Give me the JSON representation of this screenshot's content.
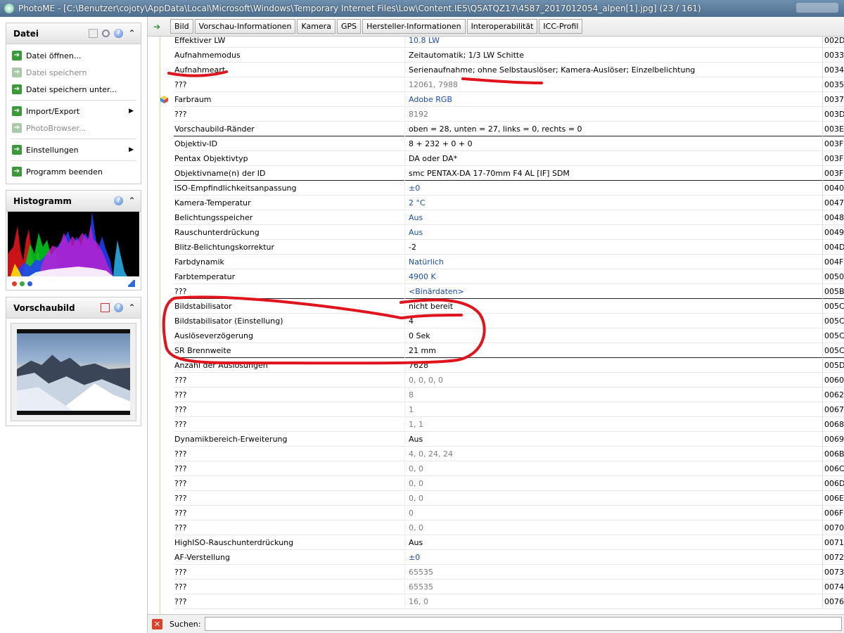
{
  "window": {
    "title": "PhotoME - [C:\\Benutzer\\cojoty\\AppData\\Local\\Microsoft\\Windows\\Temporary Internet Files\\Low\\Content.IE5\\Q5ATQZ17\\4587_2017012054_alpen[1].jpg] (23 / 161)"
  },
  "sidebar": {
    "datei": {
      "title": "Datei",
      "items": [
        {
          "label": "Datei öffnen...",
          "enabled": true
        },
        {
          "label": "Datei speichern",
          "enabled": false
        },
        {
          "label": "Datei speichern unter...",
          "enabled": true
        },
        {
          "label": "Import/Export",
          "enabled": true,
          "submenu": true
        },
        {
          "label": "PhotoBrowser...",
          "enabled": false
        },
        {
          "label": "Einstellungen",
          "enabled": true,
          "submenu": true
        },
        {
          "label": "Programm beenden",
          "enabled": true
        }
      ]
    },
    "histogram": {
      "title": "Histogramm"
    },
    "preview": {
      "title": "Vorschaubild"
    }
  },
  "toolbar": {
    "tabs": [
      "Bild",
      "Vorschau-Informationen",
      "Kamera",
      "GPS",
      "Hersteller-Informationen",
      "Interoperabilität",
      "ICC-Profil"
    ]
  },
  "rows": [
    {
      "name": "Effektiver LW",
      "value": "10.8 LW",
      "id": "002D",
      "style": "blue"
    },
    {
      "name": "Aufnahmemodus",
      "value": "Zeitautomatik; 1/3 LW Schitte",
      "id": "0033",
      "style": "normal"
    },
    {
      "name": "Aufnahmeart",
      "value": "Serienaufnahme; ohne Selbstauslöser; Kamera-Auslöser; Einzelbelichtung",
      "id": "0034",
      "style": "normal"
    },
    {
      "name": "???",
      "value": "12061, 7988",
      "id": "0035",
      "style": "grey"
    },
    {
      "name": "Farbraum",
      "value": "Adobe RGB",
      "id": "0037",
      "style": "blue",
      "icon": true
    },
    {
      "name": "???",
      "value": "8192",
      "id": "003D",
      "style": "grey"
    },
    {
      "name": "Vorschaubild-Ränder",
      "value": "oben = 28, unten = 27, links = 0, rechts = 0",
      "id": "003E",
      "style": "normal",
      "sep": true
    },
    {
      "name": "Objektiv-ID",
      "value": "8 + 232 + 0 + 0",
      "id": "003F",
      "style": "normal"
    },
    {
      "name": "Pentax Objektivtyp",
      "value": "DA oder DA*",
      "id": "003F",
      "style": "normal"
    },
    {
      "name": "Objektivname(n) der ID",
      "value": "smc PENTAX-DA 17-70mm F4 AL [IF] SDM",
      "id": "003F",
      "style": "normal",
      "sep": true
    },
    {
      "name": "ISO-Empfindlichkeitsanpassung",
      "value": "±0",
      "id": "0040",
      "style": "blue"
    },
    {
      "name": "Kamera-Temperatur",
      "value": "2 °C",
      "id": "0047",
      "style": "blue"
    },
    {
      "name": "Belichtungsspeicher",
      "value": "Aus",
      "id": "0048",
      "style": "blue"
    },
    {
      "name": "Rauschunterdrückung",
      "value": "Aus",
      "id": "0049",
      "style": "blue"
    },
    {
      "name": "Blitz-Belichtungskorrektur",
      "value": "-2",
      "id": "004D",
      "style": "normal"
    },
    {
      "name": "Farbdynamik",
      "value": "Natürlich",
      "id": "004F",
      "style": "blue"
    },
    {
      "name": "Farbtemperatur",
      "value": "4900 K",
      "id": "0050",
      "style": "blue"
    },
    {
      "name": "???",
      "value": "<Binärdaten>",
      "id": "005B",
      "style": "blue",
      "sep": true
    },
    {
      "name": "Bildstabilisator",
      "value": "nicht bereit",
      "id": "005C",
      "style": "normal"
    },
    {
      "name": "Bildstabilisator (Einstellung)",
      "value": "4",
      "id": "005C",
      "style": "normal"
    },
    {
      "name": "Auslöseverzögerung",
      "value": "0 Sek",
      "id": "005C",
      "style": "normal"
    },
    {
      "name": "SR Brennweite",
      "value": "21 mm",
      "id": "005C",
      "style": "normal",
      "sep": true
    },
    {
      "name": "Anzahl der Auslösungen",
      "value": "7628",
      "id": "005D",
      "style": "normal"
    },
    {
      "name": "???",
      "value": "0, 0, 0, 0",
      "id": "0060",
      "style": "grey"
    },
    {
      "name": "???",
      "value": "8",
      "id": "0062",
      "style": "grey"
    },
    {
      "name": "???",
      "value": "1",
      "id": "0067",
      "style": "grey"
    },
    {
      "name": "???",
      "value": "1, 1",
      "id": "0068",
      "style": "grey"
    },
    {
      "name": "Dynamikbereich-Erweiterung",
      "value": "Aus",
      "id": "0069",
      "style": "normal"
    },
    {
      "name": "???",
      "value": "4, 0, 24, 24",
      "id": "006B",
      "style": "grey"
    },
    {
      "name": "???",
      "value": "0, 0",
      "id": "006C",
      "style": "grey"
    },
    {
      "name": "???",
      "value": "0, 0",
      "id": "006D",
      "style": "grey"
    },
    {
      "name": "???",
      "value": "0, 0",
      "id": "006E",
      "style": "grey"
    },
    {
      "name": "???",
      "value": "0",
      "id": "006F",
      "style": "grey"
    },
    {
      "name": "???",
      "value": "0, 0",
      "id": "0070",
      "style": "grey"
    },
    {
      "name": "HighISO-Rauschunterdrückung",
      "value": "Aus",
      "id": "0071",
      "style": "normal"
    },
    {
      "name": "AF-Verstellung",
      "value": "±0",
      "id": "0072",
      "style": "blue"
    },
    {
      "name": "???",
      "value": "65535",
      "id": "0073",
      "style": "grey"
    },
    {
      "name": "???",
      "value": "65535",
      "id": "0074",
      "style": "grey"
    },
    {
      "name": "???",
      "value": "16, 0",
      "id": "0076",
      "style": "grey"
    }
  ],
  "search": {
    "label": "Suchen:",
    "value": ""
  },
  "colors": {
    "link_value": "#1a4ea8",
    "unknown_value": "#7b7b7b",
    "annotation": "#e0141c"
  }
}
